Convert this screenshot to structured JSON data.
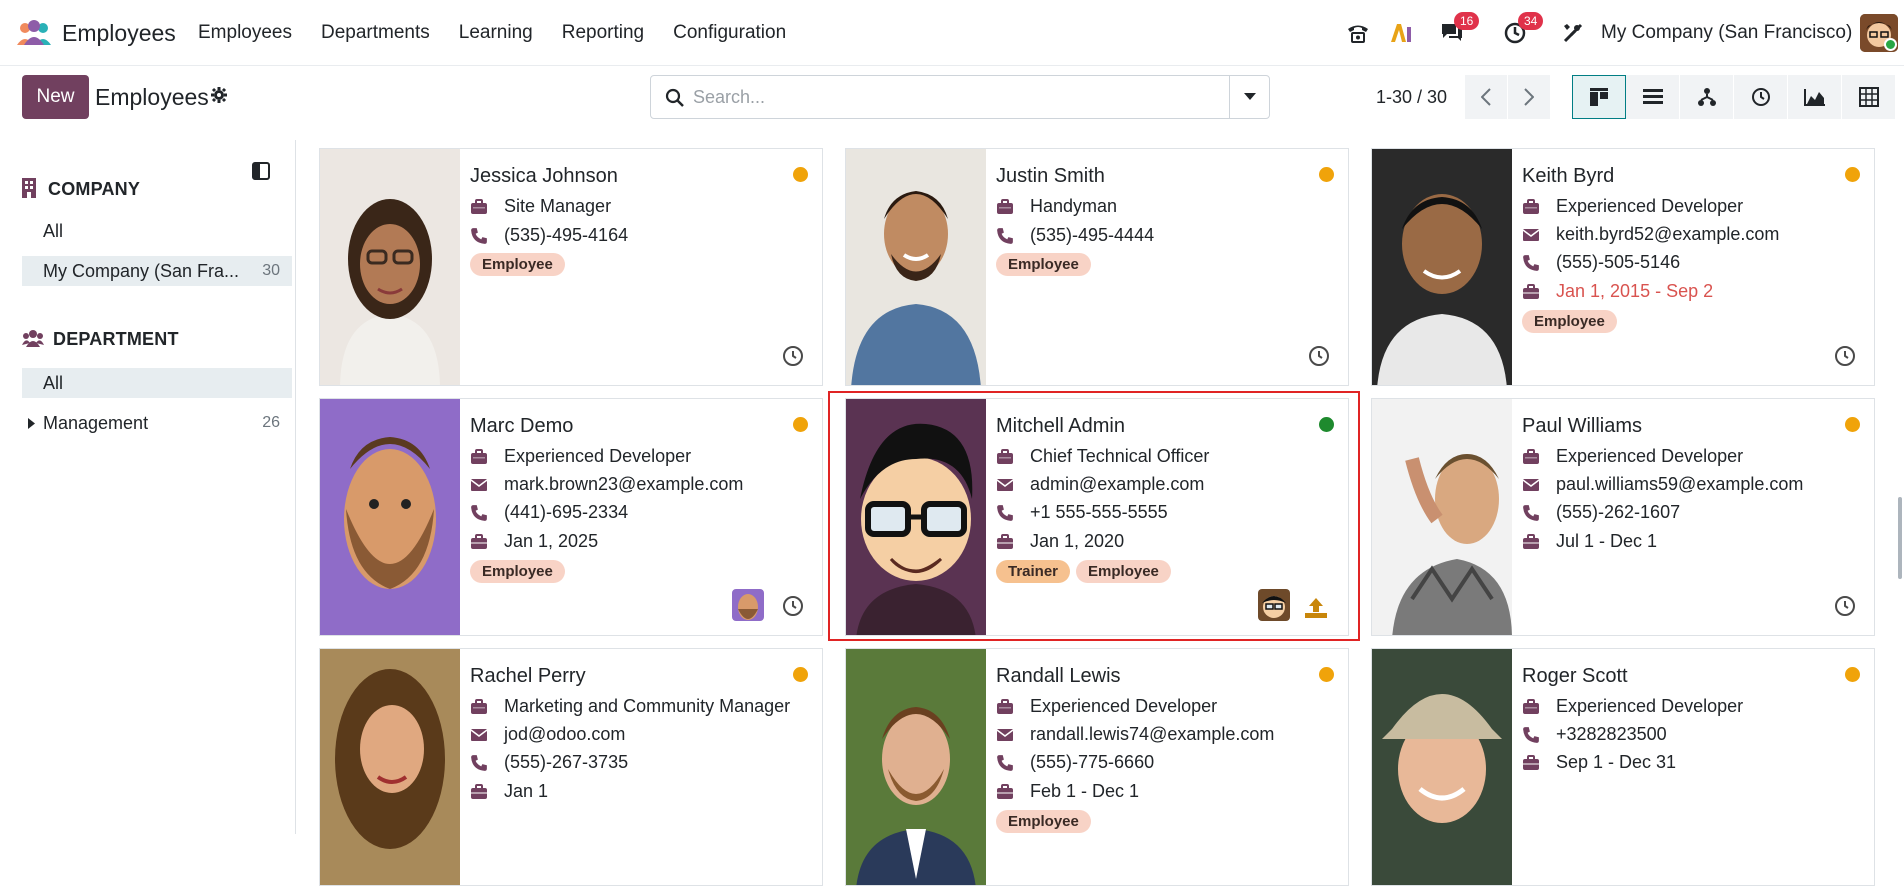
{
  "app": {
    "name": "Employees"
  },
  "menu": [
    "Employees",
    "Departments",
    "Learning",
    "Reporting",
    "Configuration"
  ],
  "systray": {
    "messages_count": "16",
    "activities_count": "34",
    "company": "My Company (San Francisco)"
  },
  "control": {
    "new_label": "New",
    "breadcrumb": "Employees",
    "search_placeholder": "Search...",
    "pager": "1-30 / 30"
  },
  "sidebar": {
    "company_title": "COMPANY",
    "company_items": [
      {
        "label": "All",
        "count": ""
      },
      {
        "label": "My Company (San Fra...",
        "count": "30"
      }
    ],
    "department_title": "DEPARTMENT",
    "department_items": [
      {
        "label": "All",
        "count": ""
      },
      {
        "label": "Management",
        "count": "26"
      }
    ]
  },
  "cards": [
    {
      "name": "Jessica Johnson",
      "job": "Site Manager",
      "phone": "(535)-495-4164",
      "tags": [
        "Employee"
      ],
      "status": "#f0a30a"
    },
    {
      "name": "Justin Smith",
      "job": "Handyman",
      "phone": "(535)-495-4444",
      "tags": [
        "Employee"
      ],
      "status": "#f0a30a"
    },
    {
      "name": "Keith Byrd",
      "job": "Experienced Developer",
      "email": "keith.byrd52@example.com",
      "phone": "(555)-505-5146",
      "contract": "Jan 1, 2015 - Sep 2",
      "tags": [
        "Employee"
      ],
      "status": "#f0a30a"
    },
    {
      "name": "Marc Demo",
      "job": "Experienced Developer",
      "email": "mark.brown23@example.com",
      "phone": "(441)-695-2334",
      "contract": "Jan 1, 2025",
      "tags": [
        "Employee"
      ],
      "status": "#f0a30a"
    },
    {
      "name": "Mitchell Admin",
      "job": "Chief Technical Officer",
      "email": "admin@example.com",
      "phone": "+1 555-555-5555",
      "contract": "Jan 1, 2020",
      "tags": [
        "Trainer",
        "Employee"
      ],
      "status": "#1e8a2e"
    },
    {
      "name": "Paul Williams",
      "job": "Experienced Developer",
      "email": "paul.williams59@example.com",
      "phone": "(555)-262-1607",
      "contract": "Jul 1 - Dec 1",
      "tags": [],
      "status": "#f0a30a"
    },
    {
      "name": "Rachel Perry",
      "job": "Marketing and Community Manager",
      "email": "jod@odoo.com",
      "phone": "(555)-267-3735",
      "contract": "Jan 1",
      "tags": [],
      "status": "#f0a30a"
    },
    {
      "name": "Randall Lewis",
      "job": "Experienced Developer",
      "email": "randall.lewis74@example.com",
      "phone": "(555)-775-6660",
      "contract": "Feb 1 - Dec 1",
      "tags": [
        "Employee"
      ],
      "status": "#f0a30a"
    },
    {
      "name": "Roger Scott",
      "job": "Experienced Developer",
      "phone": "+3282823500",
      "contract": "Sep 1 - Dec 31",
      "tags": [],
      "status": "#f0a30a"
    }
  ]
}
